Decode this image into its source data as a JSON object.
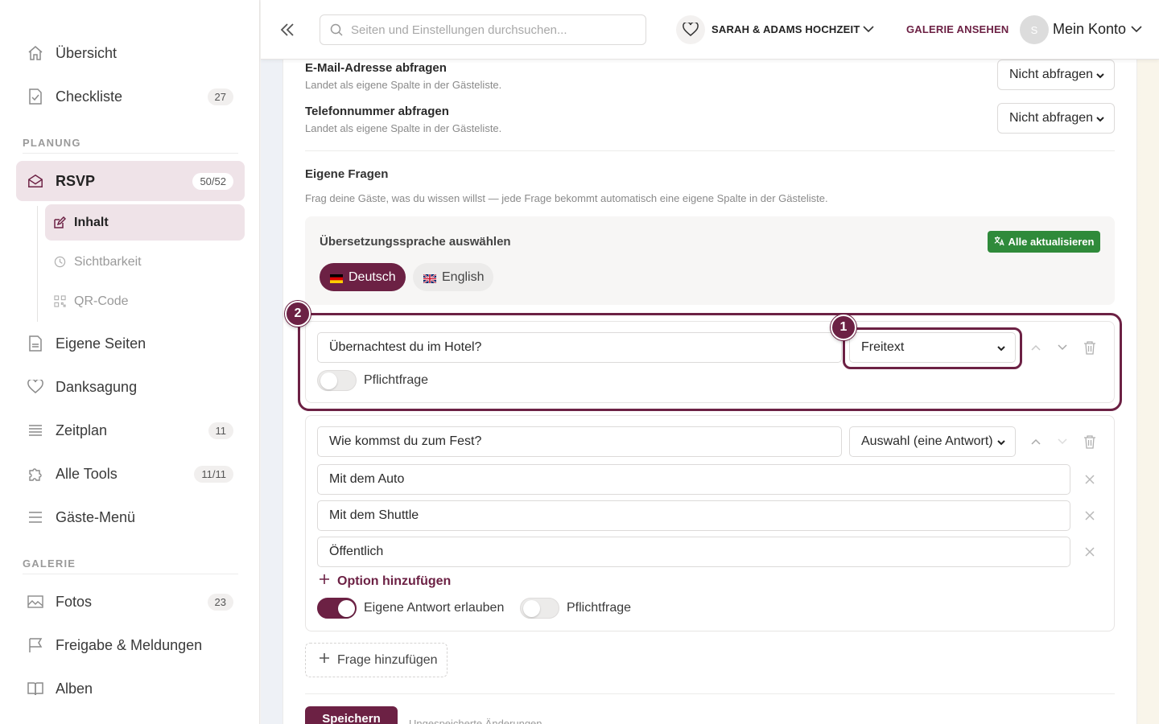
{
  "sidebar": {
    "items_top": [
      {
        "label": "Übersicht",
        "icon": "home-icon"
      },
      {
        "label": "Checkliste",
        "icon": "checklist-icon",
        "badge": "27"
      }
    ],
    "section_planning": "PLANUNG",
    "rsvp": {
      "label": "RSVP",
      "badge": "50/52",
      "icon": "envelope-open-icon"
    },
    "rsvp_sub": [
      {
        "label": "Inhalt",
        "icon": "edit-icon",
        "active": true
      },
      {
        "label": "Sichtbarkeit",
        "icon": "clock-icon"
      },
      {
        "label": "QR-Code",
        "icon": "qr-code-icon"
      }
    ],
    "items_planning": [
      {
        "label": "Eigene Seiten",
        "icon": "document-icon"
      },
      {
        "label": "Danksagung",
        "icon": "heart-icon"
      },
      {
        "label": "Zeitplan",
        "icon": "list-icon",
        "badge": "11"
      },
      {
        "label": "Alle Tools",
        "icon": "puzzle-icon",
        "badge": "11/11"
      },
      {
        "label": "Gäste-Menü",
        "icon": "menu-icon"
      }
    ],
    "section_gallery": "GALERIE",
    "items_gallery": [
      {
        "label": "Fotos",
        "icon": "image-icon",
        "badge": "23"
      },
      {
        "label": "Freigabe & Meldungen",
        "icon": "flag-icon"
      },
      {
        "label": "Alben",
        "icon": "book-icon"
      }
    ]
  },
  "topbar": {
    "search_placeholder": "Seiten und Einstellungen durchsuchen...",
    "wedding_name": "SARAH & ADAMS HOCHZEIT",
    "gallery_link": "GALERIE ANSEHEN",
    "avatar_initial": "S",
    "account_label": "Mein Konto"
  },
  "fields": [
    {
      "title": "E-Mail-Adresse abfragen",
      "desc": "Landet als eigene Spalte in der Gästeliste.",
      "value": "Nicht abfragen"
    },
    {
      "title": "Telefonnummer abfragen",
      "desc": "Landet als eigene Spalte in der Gästeliste.",
      "value": "Nicht abfragen"
    }
  ],
  "custom_questions": {
    "title": "Eigene Fragen",
    "subtitle": "Frag deine Gäste, was du wissen willst — jede Frage bekommt automatisch eine eigene Spalte in der Gästeliste.",
    "lang_title": "Übersetzungssprache auswählen",
    "update_all": "Alle aktualisieren",
    "languages": [
      {
        "label": "Deutsch",
        "active": true
      },
      {
        "label": "English",
        "active": false
      }
    ],
    "questions": [
      {
        "text": "Übernachtest du im Hotel?",
        "type": "Freitext",
        "required_label": "Pflichtfrage",
        "required": false
      },
      {
        "text": "Wie kommst du zum Fest?",
        "type": "Auswahl (eine Antwort)",
        "options": [
          "Mit dem Auto",
          "Mit dem Shuttle",
          "Öffentlich"
        ],
        "add_option": "Option hinzufügen",
        "allow_custom_label": "Eigene Antwort erlauben",
        "allow_custom": true,
        "required_label": "Pflichtfrage",
        "required": false
      }
    ],
    "add_question": "Frage hinzufügen"
  },
  "annotations": {
    "marker_1": "1",
    "marker_2": "2"
  },
  "footer": {
    "save": "Speichern",
    "unsaved": "Ungespeicherte Änderungen"
  },
  "colors": {
    "accent": "#6c2144",
    "success": "#2f8a3a"
  }
}
